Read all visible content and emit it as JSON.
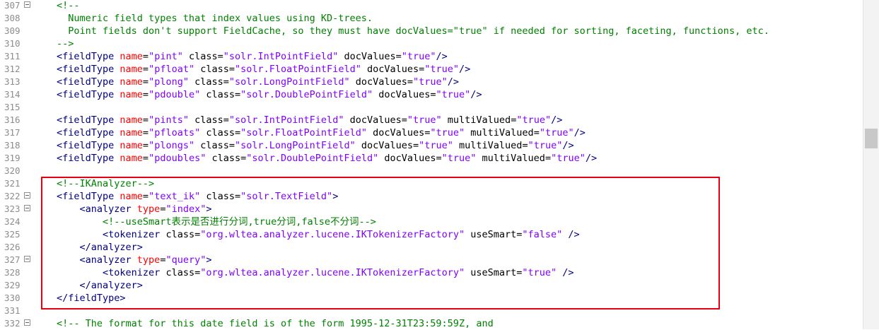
{
  "lines": [
    {
      "number": "307",
      "fold": true,
      "segments": [
        {
          "t": "<!--",
          "c": "comment"
        }
      ]
    },
    {
      "number": "308",
      "fold": false,
      "segments": [
        {
          "t": "  Numeric field types that index values using KD-trees.",
          "c": "comment"
        }
      ]
    },
    {
      "number": "309",
      "fold": false,
      "segments": [
        {
          "t": "  Point fields don't support FieldCache, so they must have docValues=\"true\" if needed for sorting, faceting, functions, etc.",
          "c": "comment"
        }
      ]
    },
    {
      "number": "310",
      "fold": false,
      "segments": [
        {
          "t": "-->",
          "c": "comment"
        }
      ]
    },
    {
      "number": "311",
      "fold": false,
      "segments": [
        {
          "t": "<fieldType ",
          "c": "tag"
        },
        {
          "t": "name",
          "c": "attr"
        },
        {
          "t": "=",
          "c": "plain"
        },
        {
          "t": "\"pint\"",
          "c": "val"
        },
        {
          "t": " class",
          "c": "plain"
        },
        {
          "t": "=",
          "c": "plain"
        },
        {
          "t": "\"solr.IntPointField\"",
          "c": "val"
        },
        {
          "t": " docValues",
          "c": "plain"
        },
        {
          "t": "=",
          "c": "plain"
        },
        {
          "t": "\"true\"",
          "c": "val"
        },
        {
          "t": "/>",
          "c": "tag"
        }
      ]
    },
    {
      "number": "312",
      "fold": false,
      "segments": [
        {
          "t": "<fieldType ",
          "c": "tag"
        },
        {
          "t": "name",
          "c": "attr"
        },
        {
          "t": "=",
          "c": "plain"
        },
        {
          "t": "\"pfloat\"",
          "c": "val"
        },
        {
          "t": " class",
          "c": "plain"
        },
        {
          "t": "=",
          "c": "plain"
        },
        {
          "t": "\"solr.FloatPointField\"",
          "c": "val"
        },
        {
          "t": " docValues",
          "c": "plain"
        },
        {
          "t": "=",
          "c": "plain"
        },
        {
          "t": "\"true\"",
          "c": "val"
        },
        {
          "t": "/>",
          "c": "tag"
        }
      ]
    },
    {
      "number": "313",
      "fold": false,
      "segments": [
        {
          "t": "<fieldType ",
          "c": "tag"
        },
        {
          "t": "name",
          "c": "attr"
        },
        {
          "t": "=",
          "c": "plain"
        },
        {
          "t": "\"plong\"",
          "c": "val"
        },
        {
          "t": " class",
          "c": "plain"
        },
        {
          "t": "=",
          "c": "plain"
        },
        {
          "t": "\"solr.LongPointField\"",
          "c": "val"
        },
        {
          "t": " docValues",
          "c": "plain"
        },
        {
          "t": "=",
          "c": "plain"
        },
        {
          "t": "\"true\"",
          "c": "val"
        },
        {
          "t": "/>",
          "c": "tag"
        }
      ]
    },
    {
      "number": "314",
      "fold": false,
      "segments": [
        {
          "t": "<fieldType ",
          "c": "tag"
        },
        {
          "t": "name",
          "c": "attr"
        },
        {
          "t": "=",
          "c": "plain"
        },
        {
          "t": "\"pdouble\"",
          "c": "val"
        },
        {
          "t": " class",
          "c": "plain"
        },
        {
          "t": "=",
          "c": "plain"
        },
        {
          "t": "\"solr.DoublePointField\"",
          "c": "val"
        },
        {
          "t": " docValues",
          "c": "plain"
        },
        {
          "t": "=",
          "c": "plain"
        },
        {
          "t": "\"true\"",
          "c": "val"
        },
        {
          "t": "/>",
          "c": "tag"
        }
      ]
    },
    {
      "number": "315",
      "fold": false,
      "segments": []
    },
    {
      "number": "316",
      "fold": false,
      "segments": [
        {
          "t": "<fieldType ",
          "c": "tag"
        },
        {
          "t": "name",
          "c": "attr"
        },
        {
          "t": "=",
          "c": "plain"
        },
        {
          "t": "\"pints\"",
          "c": "val"
        },
        {
          "t": " class",
          "c": "plain"
        },
        {
          "t": "=",
          "c": "plain"
        },
        {
          "t": "\"solr.IntPointField\"",
          "c": "val"
        },
        {
          "t": " docValues",
          "c": "plain"
        },
        {
          "t": "=",
          "c": "plain"
        },
        {
          "t": "\"true\"",
          "c": "val"
        },
        {
          "t": " multiValued",
          "c": "plain"
        },
        {
          "t": "=",
          "c": "plain"
        },
        {
          "t": "\"true\"",
          "c": "val"
        },
        {
          "t": "/>",
          "c": "tag"
        }
      ]
    },
    {
      "number": "317",
      "fold": false,
      "segments": [
        {
          "t": "<fieldType ",
          "c": "tag"
        },
        {
          "t": "name",
          "c": "attr"
        },
        {
          "t": "=",
          "c": "plain"
        },
        {
          "t": "\"pfloats\"",
          "c": "val"
        },
        {
          "t": " class",
          "c": "plain"
        },
        {
          "t": "=",
          "c": "plain"
        },
        {
          "t": "\"solr.FloatPointField\"",
          "c": "val"
        },
        {
          "t": " docValues",
          "c": "plain"
        },
        {
          "t": "=",
          "c": "plain"
        },
        {
          "t": "\"true\"",
          "c": "val"
        },
        {
          "t": " multiValued",
          "c": "plain"
        },
        {
          "t": "=",
          "c": "plain"
        },
        {
          "t": "\"true\"",
          "c": "val"
        },
        {
          "t": "/>",
          "c": "tag"
        }
      ]
    },
    {
      "number": "318",
      "fold": false,
      "segments": [
        {
          "t": "<fieldType ",
          "c": "tag"
        },
        {
          "t": "name",
          "c": "attr"
        },
        {
          "t": "=",
          "c": "plain"
        },
        {
          "t": "\"plongs\"",
          "c": "val"
        },
        {
          "t": " class",
          "c": "plain"
        },
        {
          "t": "=",
          "c": "plain"
        },
        {
          "t": "\"solr.LongPointField\"",
          "c": "val"
        },
        {
          "t": " docValues",
          "c": "plain"
        },
        {
          "t": "=",
          "c": "plain"
        },
        {
          "t": "\"true\"",
          "c": "val"
        },
        {
          "t": " multiValued",
          "c": "plain"
        },
        {
          "t": "=",
          "c": "plain"
        },
        {
          "t": "\"true\"",
          "c": "val"
        },
        {
          "t": "/>",
          "c": "tag"
        }
      ]
    },
    {
      "number": "319",
      "fold": false,
      "segments": [
        {
          "t": "<fieldType ",
          "c": "tag"
        },
        {
          "t": "name",
          "c": "attr"
        },
        {
          "t": "=",
          "c": "plain"
        },
        {
          "t": "\"pdoubles\"",
          "c": "val"
        },
        {
          "t": " class",
          "c": "plain"
        },
        {
          "t": "=",
          "c": "plain"
        },
        {
          "t": "\"solr.DoublePointField\"",
          "c": "val"
        },
        {
          "t": " docValues",
          "c": "plain"
        },
        {
          "t": "=",
          "c": "plain"
        },
        {
          "t": "\"true\"",
          "c": "val"
        },
        {
          "t": " multiValued",
          "c": "plain"
        },
        {
          "t": "=",
          "c": "plain"
        },
        {
          "t": "\"true\"",
          "c": "val"
        },
        {
          "t": "/>",
          "c": "tag"
        }
      ]
    },
    {
      "number": "320",
      "fold": false,
      "segments": []
    },
    {
      "number": "321",
      "fold": false,
      "segments": [
        {
          "t": "<!--IKAnalyzer-->",
          "c": "comment"
        }
      ]
    },
    {
      "number": "322",
      "fold": true,
      "segments": [
        {
          "t": "<fieldType ",
          "c": "tag"
        },
        {
          "t": "name",
          "c": "attr"
        },
        {
          "t": "=",
          "c": "plain"
        },
        {
          "t": "\"text_ik\"",
          "c": "val"
        },
        {
          "t": " class",
          "c": "plain"
        },
        {
          "t": "=",
          "c": "plain"
        },
        {
          "t": "\"solr.TextField\"",
          "c": "val"
        },
        {
          "t": ">",
          "c": "tag"
        }
      ]
    },
    {
      "number": "323",
      "fold": true,
      "segments": [
        {
          "t": "    <analyzer ",
          "c": "tag"
        },
        {
          "t": "type",
          "c": "attr"
        },
        {
          "t": "=",
          "c": "plain"
        },
        {
          "t": "\"index\"",
          "c": "val"
        },
        {
          "t": ">",
          "c": "tag"
        }
      ]
    },
    {
      "number": "324",
      "fold": false,
      "segments": [
        {
          "t": "        <!--useSmart表示是否进行分词,true分词,false不分词-->",
          "c": "comment"
        }
      ]
    },
    {
      "number": "325",
      "fold": false,
      "segments": [
        {
          "t": "        <tokenizer ",
          "c": "tag"
        },
        {
          "t": "class",
          "c": "plain"
        },
        {
          "t": "=",
          "c": "plain"
        },
        {
          "t": "\"org.wltea.analyzer.lucene.IKTokenizerFactory\"",
          "c": "val"
        },
        {
          "t": " useSmart",
          "c": "plain"
        },
        {
          "t": "=",
          "c": "plain"
        },
        {
          "t": "\"false\"",
          "c": "val"
        },
        {
          "t": " />",
          "c": "tag"
        }
      ]
    },
    {
      "number": "326",
      "fold": false,
      "segments": [
        {
          "t": "    </analyzer>",
          "c": "tag"
        }
      ]
    },
    {
      "number": "327",
      "fold": true,
      "segments": [
        {
          "t": "    <analyzer ",
          "c": "tag"
        },
        {
          "t": "type",
          "c": "attr"
        },
        {
          "t": "=",
          "c": "plain"
        },
        {
          "t": "\"query\"",
          "c": "val"
        },
        {
          "t": ">",
          "c": "tag"
        }
      ]
    },
    {
      "number": "328",
      "fold": false,
      "segments": [
        {
          "t": "        <tokenizer ",
          "c": "tag"
        },
        {
          "t": "class",
          "c": "plain"
        },
        {
          "t": "=",
          "c": "plain"
        },
        {
          "t": "\"org.wltea.analyzer.lucene.IKTokenizerFactory\"",
          "c": "val"
        },
        {
          "t": " useSmart",
          "c": "plain"
        },
        {
          "t": "=",
          "c": "plain"
        },
        {
          "t": "\"true\"",
          "c": "val"
        },
        {
          "t": " />",
          "c": "tag"
        }
      ]
    },
    {
      "number": "329",
      "fold": false,
      "segments": [
        {
          "t": "    </analyzer>",
          "c": "tag"
        }
      ]
    },
    {
      "number": "330",
      "fold": false,
      "segments": [
        {
          "t": "</fieldType>",
          "c": "tag"
        }
      ]
    },
    {
      "number": "331",
      "fold": false,
      "segments": []
    },
    {
      "number": "332",
      "fold": true,
      "segments": [
        {
          "t": "<!-- The format for this date field is of the form 1995-12-31T23:59:59Z, and",
          "c": "comment"
        }
      ]
    }
  ],
  "highlight": {
    "color": "#e60012"
  },
  "colors": {
    "comment": "#008000",
    "tag": "#000080",
    "attr": "#ff0000",
    "value": "#8000ff"
  }
}
